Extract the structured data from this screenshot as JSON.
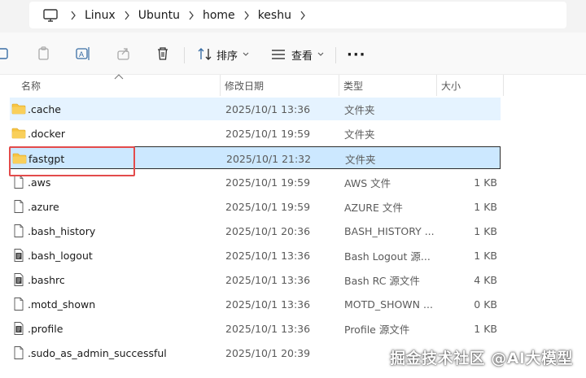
{
  "address": {
    "crumbs": [
      "Linux",
      "Ubuntu",
      "home",
      "keshu"
    ]
  },
  "toolbar": {
    "sort_label": "排序",
    "view_label": "查看",
    "more_label": "···"
  },
  "columns": {
    "name": "名称",
    "date": "修改日期",
    "type": "类型",
    "size": "大小"
  },
  "files": [
    {
      "name": ".cache",
      "date": "2025/10/1 13:36",
      "type": "文件夹",
      "size": "",
      "kind": "folder",
      "state": "hover"
    },
    {
      "name": ".docker",
      "date": "2025/10/1 19:59",
      "type": "文件夹",
      "size": "",
      "kind": "folder",
      "state": ""
    },
    {
      "name": "fastgpt",
      "date": "2025/10/1 21:32",
      "type": "文件夹",
      "size": "",
      "kind": "folder",
      "state": "selected"
    },
    {
      "name": ".aws",
      "date": "2025/10/1 19:59",
      "type": "AWS 文件",
      "size": "1 KB",
      "kind": "file",
      "state": ""
    },
    {
      "name": ".azure",
      "date": "2025/10/1 19:59",
      "type": "AZURE 文件",
      "size": "1 KB",
      "kind": "file",
      "state": ""
    },
    {
      "name": ".bash_history",
      "date": "2025/10/1 20:36",
      "type": "BASH_HISTORY ...",
      "size": "1 KB",
      "kind": "file",
      "state": ""
    },
    {
      "name": ".bash_logout",
      "date": "2025/10/1 13:36",
      "type": "Bash Logout 源...",
      "size": "1 KB",
      "kind": "script",
      "state": ""
    },
    {
      "name": ".bashrc",
      "date": "2025/10/1 13:36",
      "type": "Bash RC 源文件",
      "size": "4 KB",
      "kind": "script",
      "state": ""
    },
    {
      "name": ".motd_shown",
      "date": "2025/10/1 13:36",
      "type": "MOTD_SHOWN ...",
      "size": "0 KB",
      "kind": "file",
      "state": ""
    },
    {
      "name": ".profile",
      "date": "2025/10/1 13:36",
      "type": "Profile 源文件",
      "size": "1 KB",
      "kind": "script",
      "state": ""
    },
    {
      "name": ".sudo_as_admin_successful",
      "date": "2025/10/1 20:39",
      "type": "",
      "size": "",
      "kind": "file",
      "state": ""
    }
  ],
  "watermark": "掘金技术社区 @AI大模型",
  "colors": {
    "folder": "#f7c443",
    "selected_bg": "#cce8ff",
    "hover_bg": "#e5f3ff",
    "annotation": "#e34b4b"
  }
}
